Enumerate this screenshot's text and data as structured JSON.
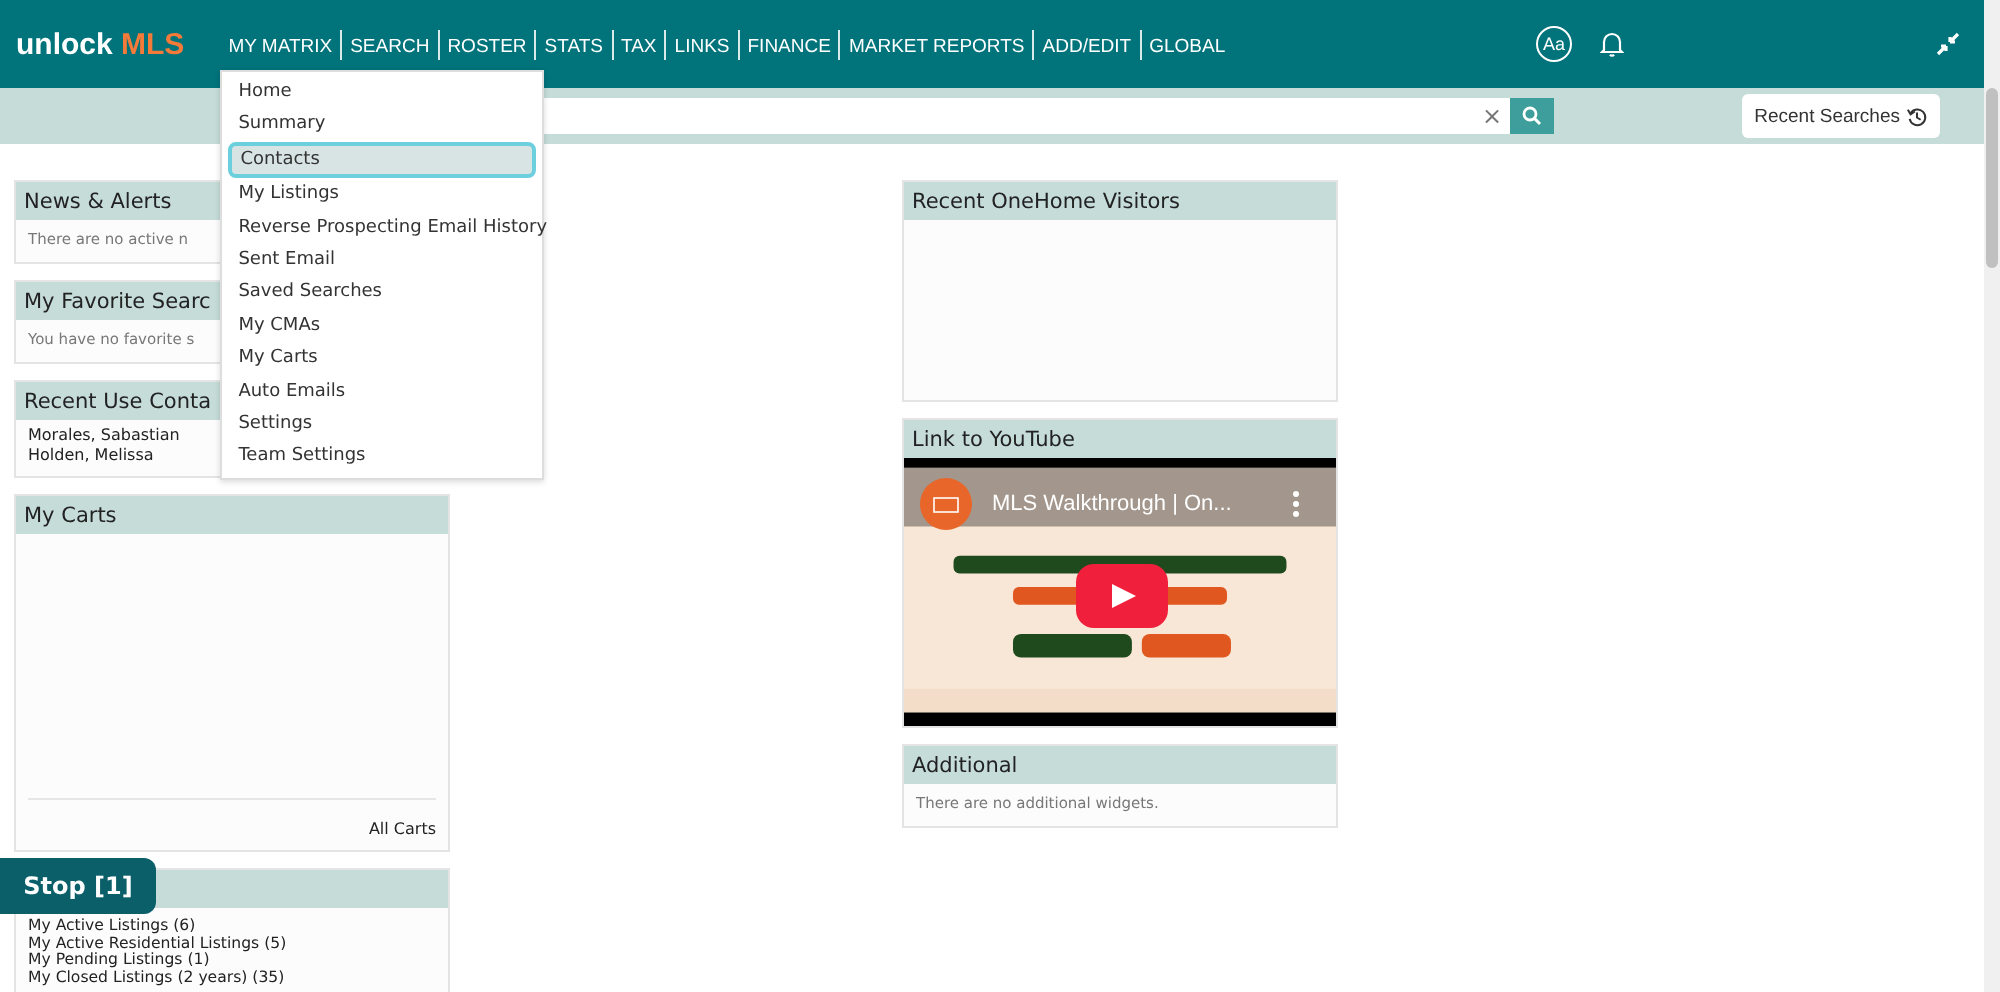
{
  "logo": {
    "word": "unlock",
    "accent": "MLS"
  },
  "nav": [
    "MY MATRIX",
    "SEARCH",
    "ROSTER",
    "STATS",
    "TAX",
    "LINKS",
    "FINANCE",
    "MARKET REPORTS",
    "ADD/EDIT",
    "GLOBAL"
  ],
  "font_button": "Aa",
  "menu": [
    {
      "label": "Home",
      "selected": false
    },
    {
      "label": "Summary",
      "selected": false
    },
    {
      "label": "Contacts",
      "selected": true
    },
    {
      "label": "My Listings",
      "selected": false
    },
    {
      "label": "Reverse Prospecting Email History",
      "selected": false
    },
    {
      "label": "Sent Email",
      "selected": false
    },
    {
      "label": "Saved Searches",
      "selected": false
    },
    {
      "label": "My CMAs",
      "selected": false
    },
    {
      "label": "My Carts",
      "selected": false
    },
    {
      "label": "Auto Emails",
      "selected": false
    },
    {
      "label": "Settings",
      "selected": false
    },
    {
      "label": "Team Settings",
      "selected": false
    }
  ],
  "search": {
    "clear": "×"
  },
  "recent_searches": "Recent Searches",
  "left_cards": [
    {
      "kind": "note",
      "title": "News & Alerts",
      "text": "There are no active n"
    },
    {
      "kind": "note",
      "title": "My Favorite Searc",
      "text": "You have no favorite s"
    },
    {
      "kind": "list",
      "title": "Recent Use Conta",
      "items": [
        "Morales, Sabastian",
        "Holden, Melissa"
      ]
    },
    {
      "kind": "carts",
      "title": "My Carts",
      "link": "All Carts"
    },
    {
      "kind": "list",
      "items": [
        "My Active Listings (6)",
        "My Active Residential Listings (5)",
        "My Pending Listings (1)",
        "My Closed Listings (2 years) (35)"
      ]
    }
  ],
  "middle_cards": [
    {
      "kind": "empty",
      "title": "Recent OneHome Visitors"
    },
    {
      "kind": "video",
      "title": "Link to YouTube",
      "video_title": "MLS Walkthrough | On..."
    },
    {
      "kind": "note",
      "title": "Additional",
      "text": "There are no additional widgets."
    }
  ],
  "stop_button": "Stop [1]"
}
